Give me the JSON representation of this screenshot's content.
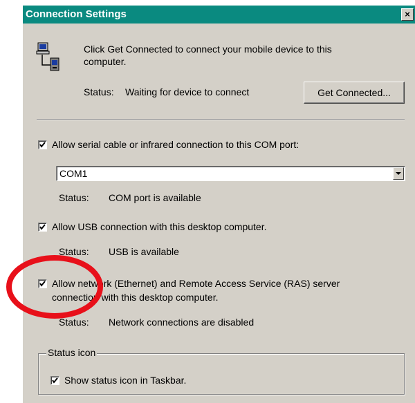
{
  "window": {
    "title": "Connection Settings",
    "close_glyph": "×"
  },
  "intro": {
    "icon": "device-connection-icon",
    "text_line1": "Click Get Connected to connect your mobile device to this",
    "text_line2": "computer.",
    "status_label": "Status:",
    "status_value": "Waiting for device to connect",
    "get_connected_label": "Get Connected..."
  },
  "serial": {
    "checked": true,
    "label": "Allow serial cable or infrared connection to this COM port:",
    "port_value": "COM1",
    "status_label": "Status:",
    "status_value": "COM port is available"
  },
  "usb": {
    "checked": true,
    "label": "Allow USB connection with this desktop computer.",
    "status_label": "Status:",
    "status_value": "USB is available"
  },
  "network": {
    "checked": true,
    "label_line1": "Allow network (Ethernet) and Remote Access Service (RAS) server",
    "label_line2": "connection with this desktop computer.",
    "status_label": "Status:",
    "status_value": "Network connections are disabled"
  },
  "status_icon_group": {
    "legend": "Status icon",
    "checked": true,
    "label": "Show status icon in Taskbar."
  },
  "colors": {
    "titlebar": "#0a8a80",
    "dialog_face": "#d4d0c8",
    "highlight_ring": "#e8101a"
  }
}
